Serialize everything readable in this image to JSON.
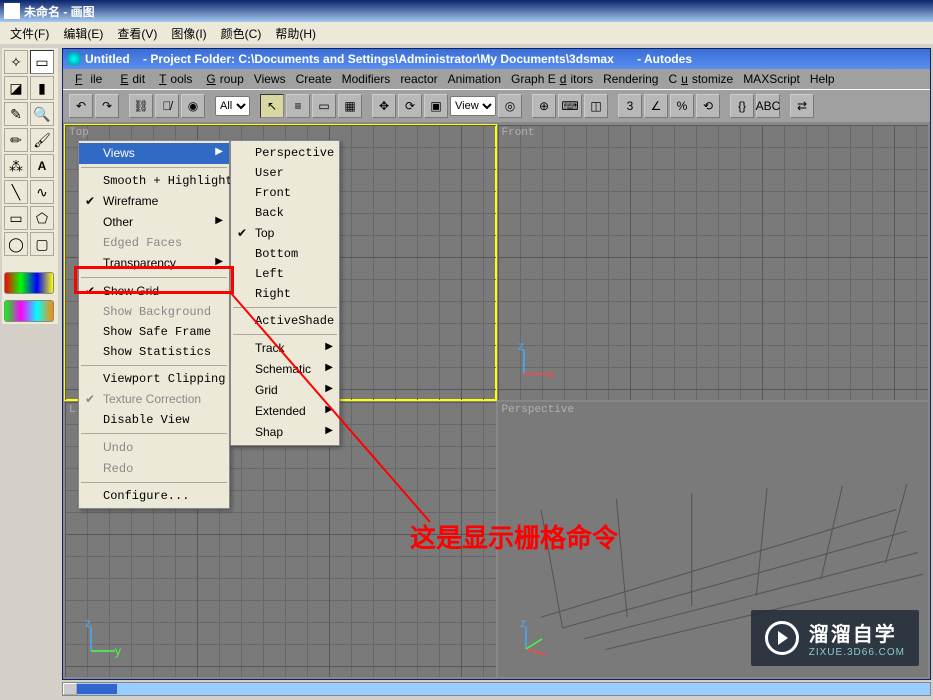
{
  "outer": {
    "title": "未命名 - 画图",
    "menu": [
      "文件(F)",
      "编辑(E)",
      "查看(V)",
      "图像(I)",
      "颜色(C)",
      "帮助(H)"
    ]
  },
  "inner": {
    "title_doc": "Untitled",
    "title_sep": "    - ",
    "title_project": "Project Folder: C:\\Documents and Settings\\Administrator\\My Documents\\3dsmax",
    "title_app": "       - Autodes",
    "menu": [
      "File",
      "Edit",
      "Tools",
      "Group",
      "Views",
      "Create",
      "Modifiers",
      "reactor",
      "Animation",
      "Graph Editors",
      "Rendering",
      "Customize",
      "MAXScript",
      "Help"
    ],
    "toolbar": {
      "dropdown1": "All",
      "dropdown2": "View"
    }
  },
  "viewports": {
    "tl": "Top",
    "tr": "Front",
    "bl": "L",
    "br": "Perspective",
    "axis_z": "z",
    "axis_x": "x",
    "axis_y": "y"
  },
  "context_main": {
    "views": "Views",
    "smooth": "Smooth + Highlights",
    "wireframe": "Wireframe",
    "other": "Other",
    "edged": "Edged Faces",
    "transparency": "Transparency",
    "show_grid": "Show Grid",
    "show_bg": "Show Background",
    "safe_frame": "Show Safe Frame",
    "statistics": "Show Statistics",
    "clipping": "Viewport Clipping",
    "texture": "Texture Correction",
    "disable": "Disable View",
    "undo": "Undo",
    "redo": "Redo",
    "configure": "Configure..."
  },
  "context_sub": {
    "perspective": "Perspective",
    "user": "User",
    "front": "Front",
    "back": "Back",
    "top": "Top",
    "bottom": "Bottom",
    "left": "Left",
    "right": "Right",
    "activeshade": "ActiveShade",
    "track": "Track",
    "schematic": "Schematic",
    "grid": "Grid",
    "extended": "Extended",
    "shape": "Shap"
  },
  "annotation": "这是显示栅格命令",
  "watermark": {
    "line1": "溜溜自学",
    "line2": "ZIXUE.3D66.COM"
  }
}
